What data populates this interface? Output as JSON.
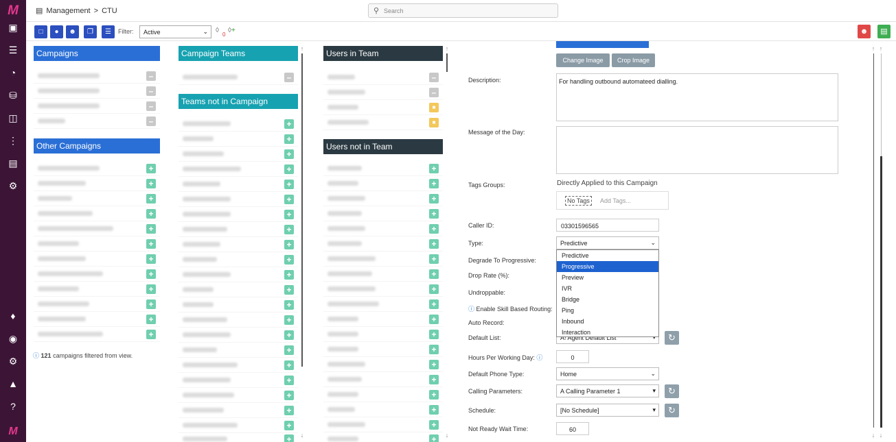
{
  "app": {
    "brand": "M",
    "breadcrumb_section": "Management",
    "breadcrumb_sep": ">",
    "breadcrumb_page": "CTU"
  },
  "search": {
    "placeholder": "Search"
  },
  "toolbar": {
    "filter_label": "Filter:",
    "filter_value": "Active",
    "tag_count": "0"
  },
  "nav_icons": [
    "briefcase-icon",
    "sliders-icon",
    "dashboard-icon",
    "database-icon",
    "files-icon",
    "waveform-icon",
    "report-icon",
    "cogs-icon",
    "puzzle-icon",
    "globe-icon",
    "settings-icon",
    "bell-icon",
    "help-icon"
  ],
  "panels": {
    "campaigns": {
      "title": "Campaigns"
    },
    "other_campaigns": {
      "title": "Other Campaigns"
    },
    "campaign_teams": {
      "title": "Campaign Teams"
    },
    "teams_not_in_campaign": {
      "title": "Teams not in Campaign"
    },
    "users_in_team": {
      "title": "Users in Team"
    },
    "users_not_in_team": {
      "title": "Users not in Team"
    }
  },
  "campaigns_note": {
    "count": "121",
    "text": " campaigns filtered from view."
  },
  "form": {
    "change_image": "Change Image",
    "crop_image": "Crop Image",
    "description_label": "Description:",
    "description_value": "For handling outbound automateed dialling.",
    "motd_label": "Message of the Day:",
    "tags_groups_label": "Tags Groups:",
    "tags_applied": "Directly Applied to this Campaign",
    "no_tags": "No Tags",
    "add_tags": "Add Tags...",
    "caller_id_label": "Caller ID:",
    "caller_id_value": "03301596565",
    "type_label": "Type:",
    "type_value": "Predictive",
    "type_options": [
      "Predictive",
      "Progressive",
      "Preview",
      "IVR",
      "Bridge",
      "Ping",
      "Inbound",
      "Interaction"
    ],
    "degrade_label": "Degrade To Progressive:",
    "drop_rate_label": "Drop Rate (%):",
    "undroppable_label": "Undroppable:",
    "skill_routing_label": "Enable Skill Based Routing:",
    "auto_record_label": "Auto Record:",
    "default_list_label": "Default List:",
    "default_list_value": "A! Agent Default List",
    "hours_label": "Hours Per Working Day:",
    "hours_value": "0",
    "phone_type_label": "Default Phone Type:",
    "phone_type_value": "Home",
    "calling_params_label": "Calling Parameters:",
    "calling_params_value": "A Calling Parameter 1",
    "schedule_label": "Schedule:",
    "schedule_value": "[No Schedule]",
    "not_ready_label": "Not Ready Wait Time:",
    "not_ready_value": "60"
  },
  "colors": {
    "nav": "#3c1536",
    "campaigns_header": "#2a6fd6",
    "teams_header": "#17a2b1",
    "users_header": "#2b3a42",
    "highlight": "#1e62d0"
  }
}
